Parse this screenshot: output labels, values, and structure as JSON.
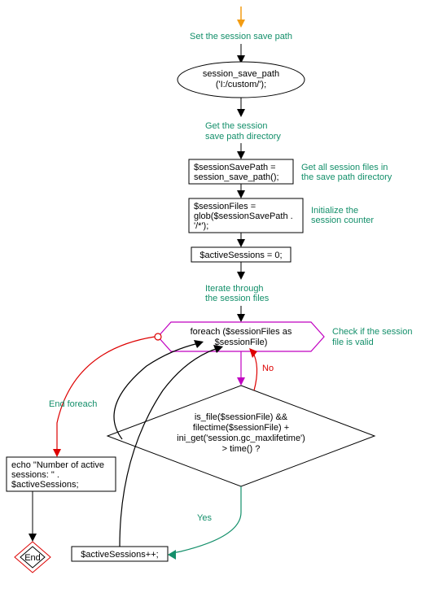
{
  "annotations": {
    "title": "Set the session save path",
    "getPathDir": "Get the session\nsave path directory",
    "getAllFiles": "Get all session files in\nthe save path directory",
    "initCounter": "Initialize the\nsession counter",
    "iterate": "Iterate through\nthe session files",
    "checkValid": "Check if the session\nfile is valid",
    "endForeach": "End foreach"
  },
  "nodes": {
    "setPath": "session_save_path\n('I:/custom/');",
    "assignPath": "$sessionSavePath =\nsession_save_path();",
    "globFiles": "$sessionFiles =\nglob($sessionSavePath .\n'/*');",
    "initZero": "$activeSessions = 0;",
    "foreach": "foreach ($sessionFiles as\n$sessionFile)",
    "condition": "is_file($sessionFile) &&\nfilectime($sessionFile) +\nini_get('session.gc_maxlifetime')\n> time() ?",
    "increment": "$activeSessions++;",
    "echo": "echo \"Number of active\nsessions: \" .\n$activeSessions;",
    "end": "End"
  },
  "labels": {
    "yes": "Yes",
    "no": "No"
  }
}
